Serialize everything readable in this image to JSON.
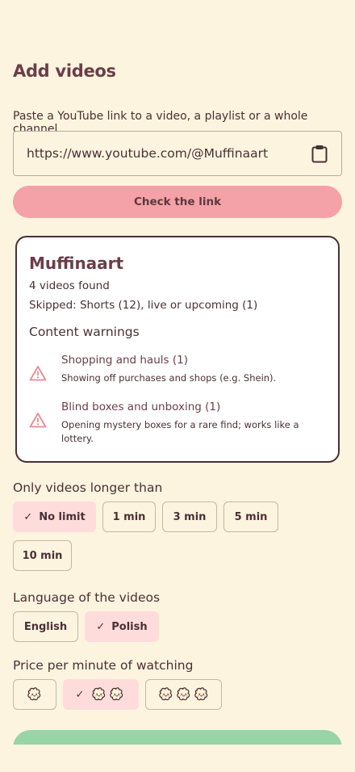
{
  "header": {
    "title": "Add videos",
    "subtitle": "Paste a YouTube link to a video, a playlist or a whole channel."
  },
  "link_input": {
    "value": "https://www.youtube.com/@Muffinaart",
    "icon": "clipboard-icon"
  },
  "check_button": {
    "label": "Check the link"
  },
  "result": {
    "channel_name": "Muffinaart",
    "found": "4 videos found",
    "skipped": "Skipped: Shorts (12), live or upcoming (1)",
    "warnings_title": "Content warnings",
    "warnings": [
      {
        "label": "Shopping and hauls (1)",
        "description": "Showing off purchases and shops (e.g. Shein).",
        "icon": "warning-icon"
      },
      {
        "label": "Blind boxes and unboxing (1)",
        "description": "Opening mystery boxes for a rare find; works like a lottery.",
        "icon": "warning-icon"
      }
    ]
  },
  "duration": {
    "label": "Only videos longer than",
    "options": [
      "No limit",
      "1 min",
      "3 min",
      "5 min",
      "10 min"
    ],
    "selected": "No limit"
  },
  "language": {
    "label": "Language of the videos",
    "options": [
      "English",
      "Polish"
    ],
    "selected": "Polish"
  },
  "price": {
    "label": "Price per minute of watching",
    "options": [
      1,
      2,
      3
    ],
    "selected": 2,
    "icon": "muffin-icon"
  },
  "colors": {
    "background": "#fdf4df",
    "accent_pink": "#f4a2a7",
    "selected_chip": "#ffdcdc",
    "warning": "#e88a92",
    "primary_green": "#98d4a6",
    "heading": "#6b3e48"
  }
}
